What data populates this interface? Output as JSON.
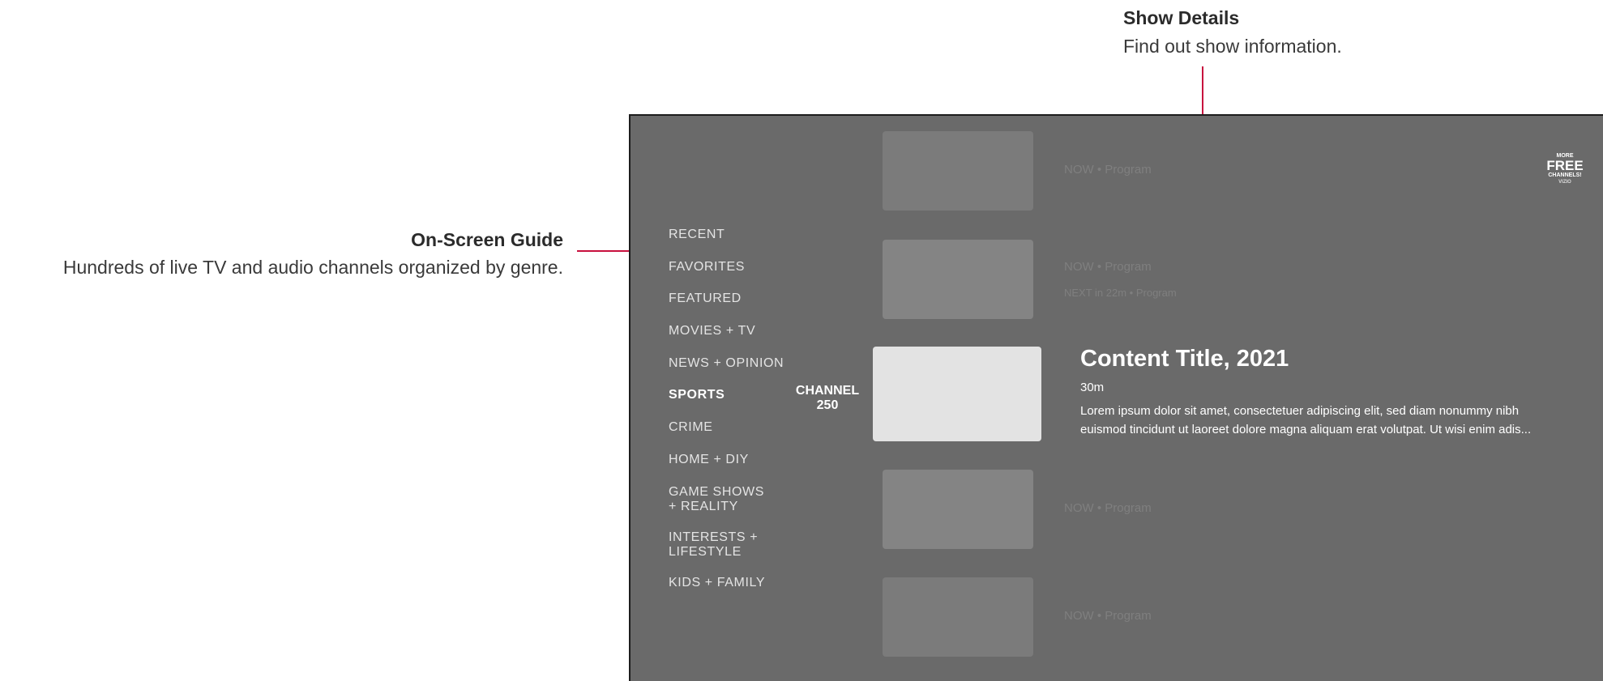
{
  "callouts": {
    "show_details": {
      "title": "Show Details",
      "description": "Find out show information."
    },
    "on_screen_guide": {
      "title": "On-Screen Guide",
      "description": "Hundreds of live TV and audio channels organized by genre."
    }
  },
  "guide": {
    "genres": [
      {
        "label": "RECENT"
      },
      {
        "label": "FAVORITES"
      },
      {
        "label": "FEATURED"
      },
      {
        "label": "MOVIES + TV"
      },
      {
        "label": "NEWS + OPINION"
      },
      {
        "label": "SPORTS"
      },
      {
        "label": "CRIME"
      },
      {
        "label": "HOME + DIY"
      },
      {
        "label": "GAME SHOWS + REALITY"
      },
      {
        "label": "INTERESTS + LIFESTYLE"
      },
      {
        "label": "KIDS + FAMILY"
      }
    ],
    "active_genre": "SPORTS",
    "channel_label": "CHANNEL 250",
    "programs": [
      {
        "now": "NOW • Program"
      },
      {
        "now": "NOW • Program",
        "next": "NEXT in 22m • Program"
      },
      {
        "now": "NOW • Program"
      },
      {
        "now": "NOW • Program"
      }
    ],
    "selected": {
      "title": "Content Title, 2021",
      "duration": "30m",
      "description": "Lorem ipsum dolor sit amet, consectetuer adipiscing elit, sed diam nonummy nibh euismod tincidunt ut laoreet dolore magna aliquam erat volutpat. Ut wisi enim adis..."
    },
    "logo": {
      "line1": "MORE",
      "line2": "FREE",
      "line3": "CHANNELS!",
      "line4": "VIZIO"
    }
  },
  "colors": {
    "accent": "#c8103e",
    "screen_bg": "#6a6a6a"
  }
}
